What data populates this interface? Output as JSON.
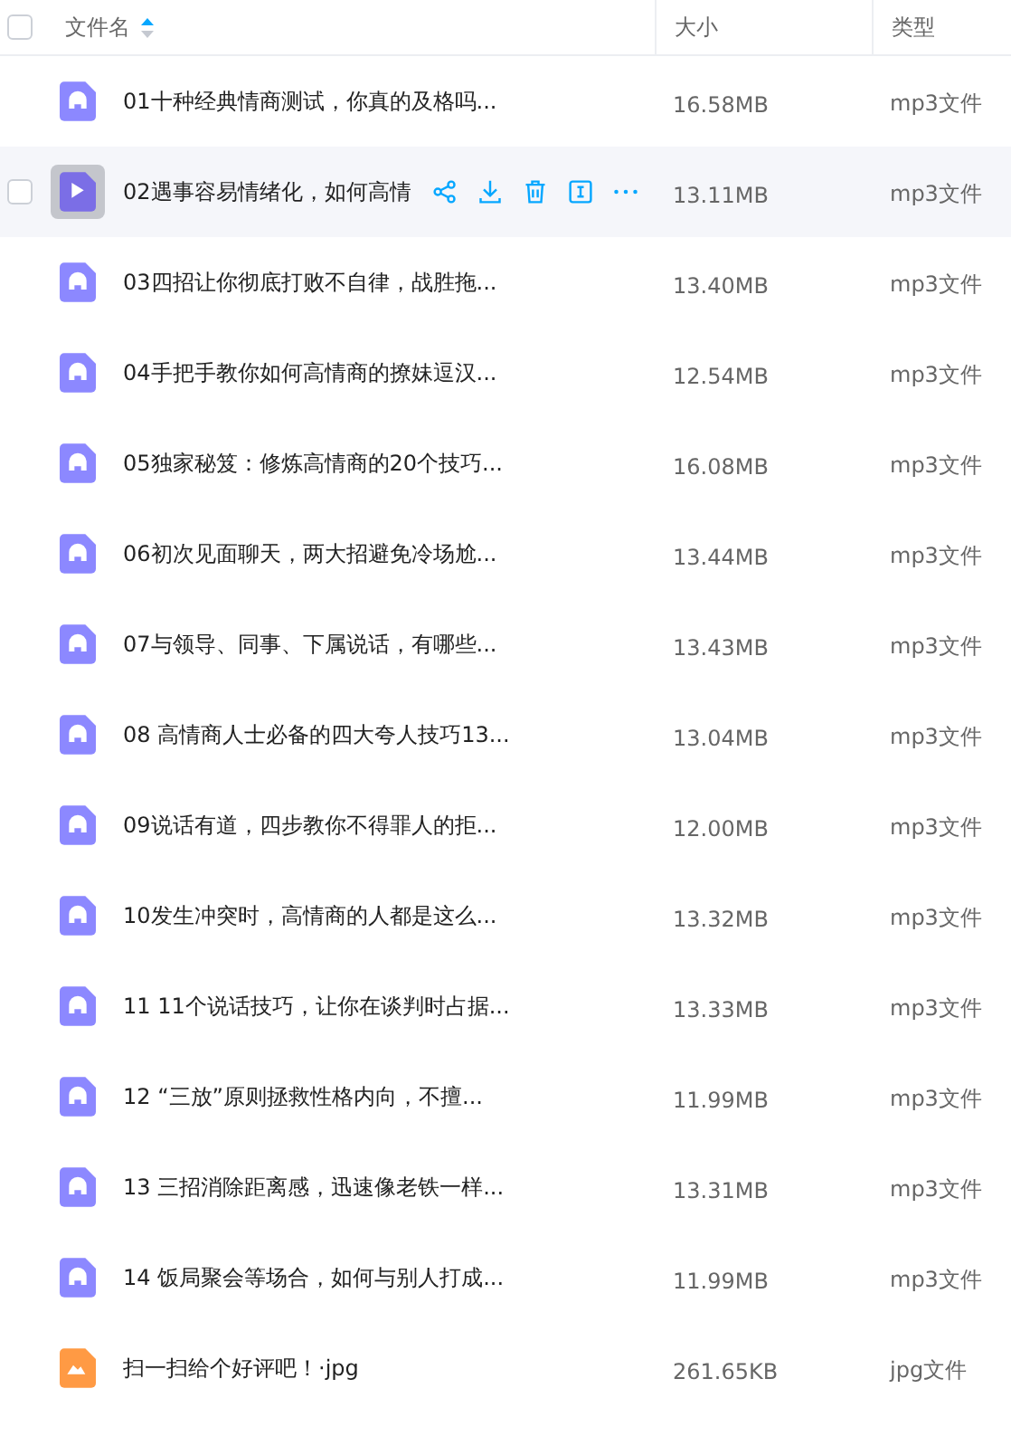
{
  "header": {
    "checked": false,
    "columns": [
      {
        "label": "文件名",
        "sorted": true
      },
      {
        "label": "大小",
        "sorted": false
      },
      {
        "label": "类型",
        "sorted": false
      }
    ]
  },
  "files": [
    {
      "name": "01十种经典情商测试，你真的及格吗...",
      "size": "16.58MB",
      "type": "mp3文件",
      "kind": "audio",
      "hovered": false
    },
    {
      "name": "02遇事容易情绪化，如何高情",
      "size": "13.11MB",
      "type": "mp3文件",
      "kind": "audio",
      "hovered": true
    },
    {
      "name": "03四招让你彻底打败不自律，战胜拖...",
      "size": "13.40MB",
      "type": "mp3文件",
      "kind": "audio",
      "hovered": false
    },
    {
      "name": "04手把手教你如何高情商的撩妹逗汉...",
      "size": "12.54MB",
      "type": "mp3文件",
      "kind": "audio",
      "hovered": false
    },
    {
      "name": "05独家秘笈：修炼高情商的20个技巧...",
      "size": "16.08MB",
      "type": "mp3文件",
      "kind": "audio",
      "hovered": false
    },
    {
      "name": "06初次见面聊天，两大招避免冷场尬...",
      "size": "13.44MB",
      "type": "mp3文件",
      "kind": "audio",
      "hovered": false
    },
    {
      "name": "07与领导、同事、下属说话，有哪些...",
      "size": "13.43MB",
      "type": "mp3文件",
      "kind": "audio",
      "hovered": false
    },
    {
      "name": "08 高情商人士必备的四大夸人技巧13...",
      "size": "13.04MB",
      "type": "mp3文件",
      "kind": "audio",
      "hovered": false
    },
    {
      "name": "09说话有道，四步教你不得罪人的拒...",
      "size": "12.00MB",
      "type": "mp3文件",
      "kind": "audio",
      "hovered": false
    },
    {
      "name": "10发生冲突时，高情商的人都是这么...",
      "size": "13.32MB",
      "type": "mp3文件",
      "kind": "audio",
      "hovered": false
    },
    {
      "name": "11 11个说话技巧，让你在谈判时占据...",
      "size": "13.33MB",
      "type": "mp3文件",
      "kind": "audio",
      "hovered": false
    },
    {
      "name": "12 “三放”原则拯救性格内向，不擅...",
      "size": "11.99MB",
      "type": "mp3文件",
      "kind": "audio",
      "hovered": false
    },
    {
      "name": "13 三招消除距离感，迅速像老铁一样...",
      "size": "13.31MB",
      "type": "mp3文件",
      "kind": "audio",
      "hovered": false
    },
    {
      "name": "14 饭局聚会等场合，如何与别人打成...",
      "size": "11.99MB",
      "type": "mp3文件",
      "kind": "audio",
      "hovered": false
    },
    {
      "name": "扫一扫给个好评吧！·jpg",
      "size": "261.65KB",
      "type": "jpg文件",
      "kind": "image",
      "hovered": false
    }
  ]
}
